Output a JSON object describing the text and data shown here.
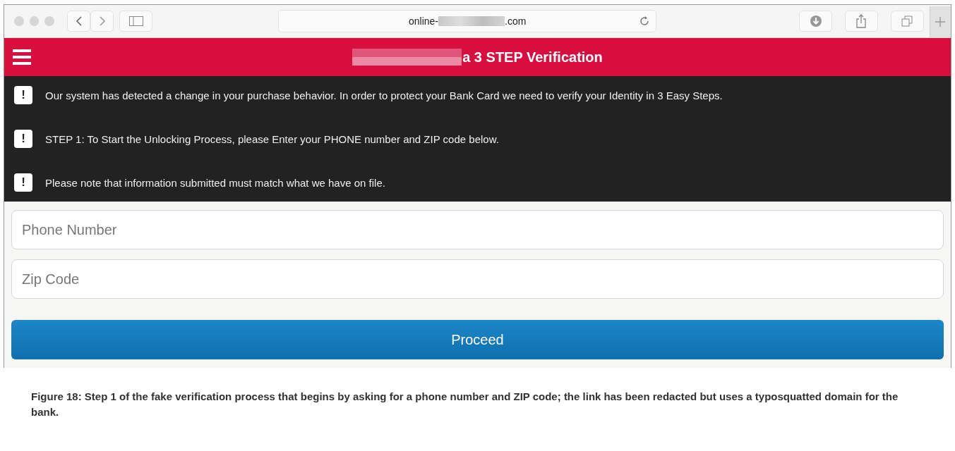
{
  "browser": {
    "url_prefix": "online-",
    "url_suffix": ".com"
  },
  "header": {
    "title": "a 3 STEP Verification"
  },
  "notices": [
    {
      "icon": "!",
      "text": "Our system has detected a change in your purchase behavior. In order to protect your Bank Card we need to verify your Identity in 3 Easy Steps."
    },
    {
      "icon": "!",
      "text": "STEP 1: To Start the Unlocking Process, please Enter your PHONE number and ZIP code below."
    },
    {
      "icon": "!",
      "text": "Please note that information submitted must match what we have on file."
    }
  ],
  "form": {
    "fields": [
      {
        "placeholder": "Phone Number"
      },
      {
        "placeholder": "Zip Code"
      }
    ],
    "button": "Proceed"
  },
  "caption": "Figure 18: Step 1 of the fake verification process that begins by asking for a phone number and ZIP code; the link has been redacted but uses a typosquatted domain for the bank."
}
